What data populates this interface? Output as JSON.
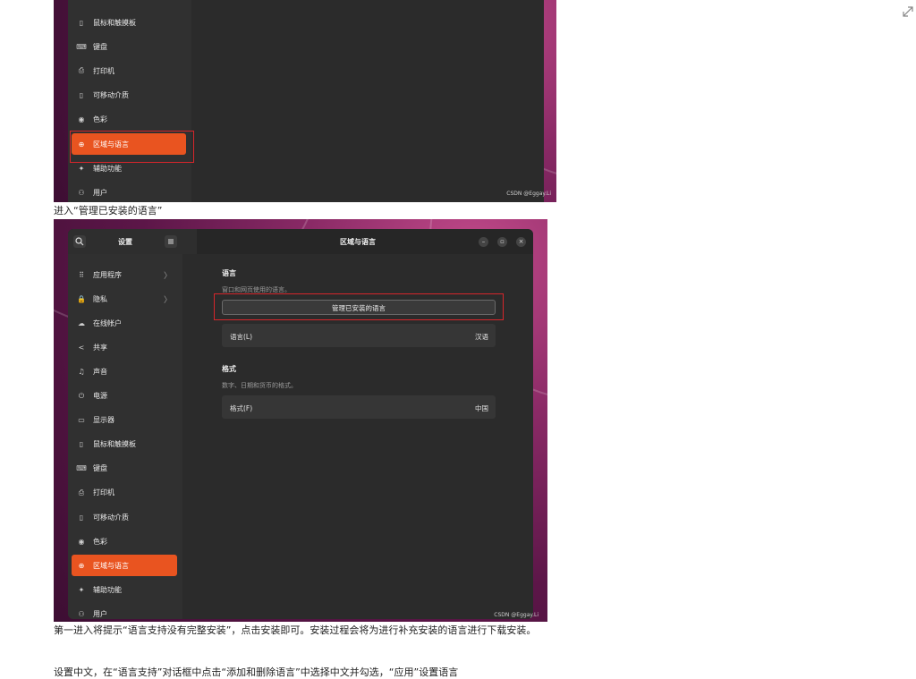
{
  "shot1": {
    "menu_items": [
      {
        "icon": "mouse-icon",
        "glyph": "▯",
        "label": "鼠标和触摸板"
      },
      {
        "icon": "keyboard-icon",
        "glyph": "⌨",
        "label": "键盘"
      },
      {
        "icon": "printer-icon",
        "glyph": "⎙",
        "label": "打印机"
      },
      {
        "icon": "usb-drive-icon",
        "glyph": "▯",
        "label": "可移动介质"
      },
      {
        "icon": "color-icon",
        "glyph": "◉",
        "label": "色彩"
      },
      {
        "icon": "globe-icon",
        "glyph": "⊕",
        "label": "区域与语言",
        "selected": true
      },
      {
        "icon": "accessibility-icon",
        "glyph": "✦",
        "label": "辅助功能"
      },
      {
        "icon": "users-icon",
        "glyph": "⚇",
        "label": "用户"
      }
    ],
    "watermark": "CSDN @Eggay.Li"
  },
  "caption1": "进入“管理已安装的语言”",
  "shot2": {
    "sidebar_title": "设置",
    "window_title": "区域与语言",
    "menu_items": [
      {
        "icon": "apps-icon",
        "glyph": "⠿",
        "label": "应用程序",
        "chevron": "〉"
      },
      {
        "icon": "lock-icon",
        "glyph": "🔒",
        "label": "隐私",
        "chevron": "〉"
      },
      {
        "icon": "cloud-icon",
        "glyph": "☁",
        "label": "在线帐户"
      },
      {
        "icon": "share-icon",
        "glyph": "<",
        "label": "共享"
      },
      {
        "icon": "music-icon",
        "glyph": "♫",
        "label": "声音"
      },
      {
        "icon": "power-icon",
        "glyph": "⏻",
        "label": "电源"
      },
      {
        "icon": "display-icon",
        "glyph": "▭",
        "label": "显示器"
      },
      {
        "icon": "mouse-icon",
        "glyph": "▯",
        "label": "鼠标和触摸板"
      },
      {
        "icon": "keyboard-icon",
        "glyph": "⌨",
        "label": "键盘"
      },
      {
        "icon": "printer-icon",
        "glyph": "⎙",
        "label": "打印机"
      },
      {
        "icon": "usb-drive-icon",
        "glyph": "▯",
        "label": "可移动介质"
      },
      {
        "icon": "color-icon",
        "glyph": "◉",
        "label": "色彩"
      },
      {
        "icon": "globe-icon",
        "glyph": "⊕",
        "label": "区域与语言",
        "selected": true
      },
      {
        "icon": "accessibility-icon",
        "glyph": "✦",
        "label": "辅助功能"
      },
      {
        "icon": "users-icon",
        "glyph": "⚇",
        "label": "用户"
      }
    ],
    "language_section": {
      "title": "语言",
      "description": "窗口和网页使用的语言。",
      "manage_button": "管理已安装的语言",
      "row_label": "语言(L)",
      "row_value": "汉语"
    },
    "format_section": {
      "title": "格式",
      "description": "数字、日期和货币的格式。",
      "row_label": "格式(F)",
      "row_value": "中国"
    },
    "watermark": "CSDN @Eggay.Li"
  },
  "caption2": "第一进入将提示“语言支持没有完整安装”，点击安装即可。安装过程会将为进行补充安装的语言进行下载安装。",
  "caption3": "设置中文，在“语言支持”对话框中点击“添加和删除语言”中选择中文并勾选，“应用”设置语言"
}
